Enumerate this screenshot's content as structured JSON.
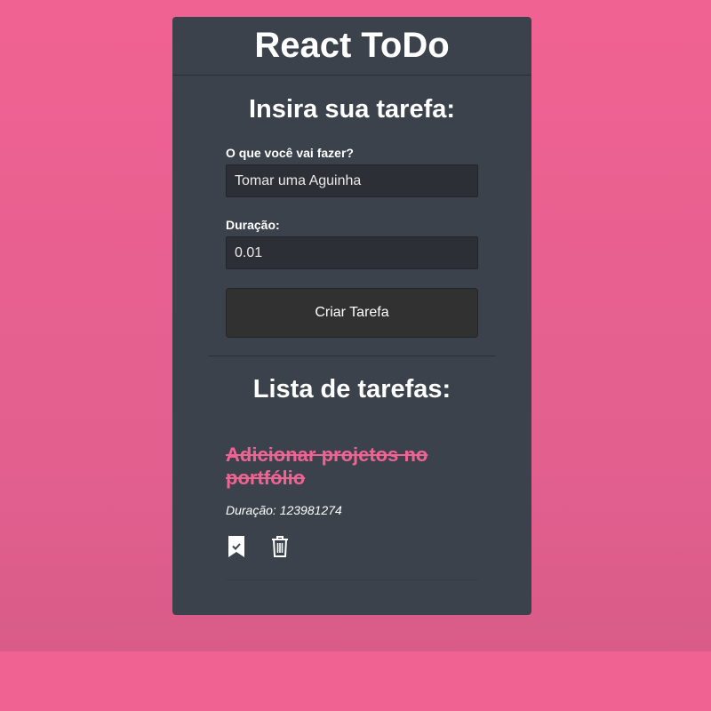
{
  "app": {
    "title": "React ToDo"
  },
  "form": {
    "title": "Insira sua tarefa:",
    "task_label": "O que você vai fazer?",
    "task_value": "Tomar uma Aguinha",
    "duration_label": "Duração:",
    "duration_value": "0.01",
    "submit_label": "Criar Tarefa"
  },
  "list": {
    "title": "Lista de tarefas:",
    "items": [
      {
        "name": "Adicionar projetos no portfólio",
        "duration": "Duração: 123981274",
        "completed": true,
        "icons": [
          "bookmark-check-icon",
          "trash-icon"
        ]
      }
    ]
  },
  "colors": {
    "background": "#f06292",
    "card": "#3b424c",
    "accent": "#f06292"
  }
}
